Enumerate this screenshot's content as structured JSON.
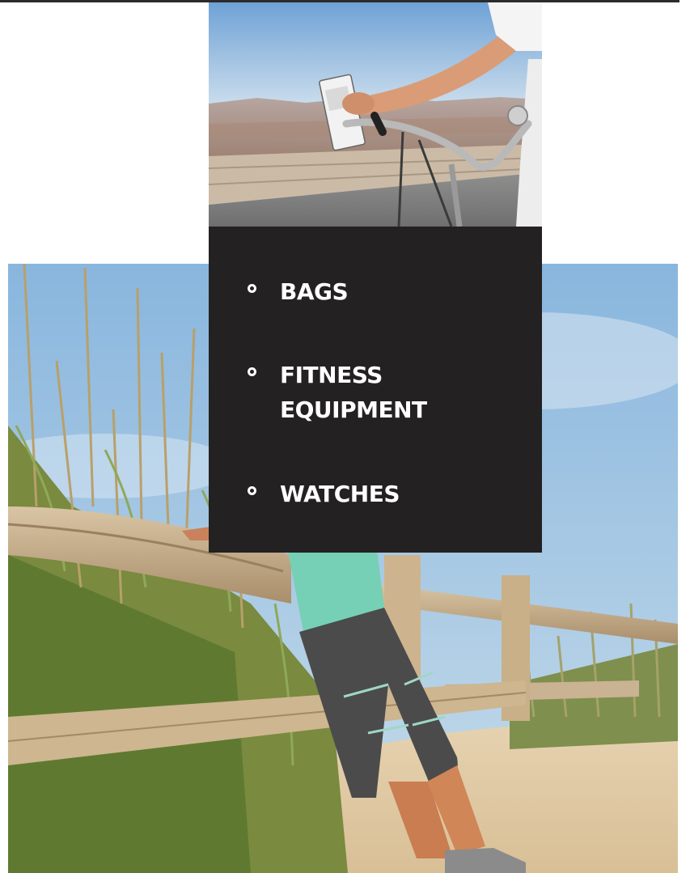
{
  "categories": {
    "items": [
      {
        "label": "BAGS"
      },
      {
        "label": "FITNESS EQUIPMENT"
      },
      {
        "label": "WATCHES"
      }
    ]
  },
  "colors": {
    "panel_background": "#232121",
    "panel_text": "#ffffff"
  }
}
